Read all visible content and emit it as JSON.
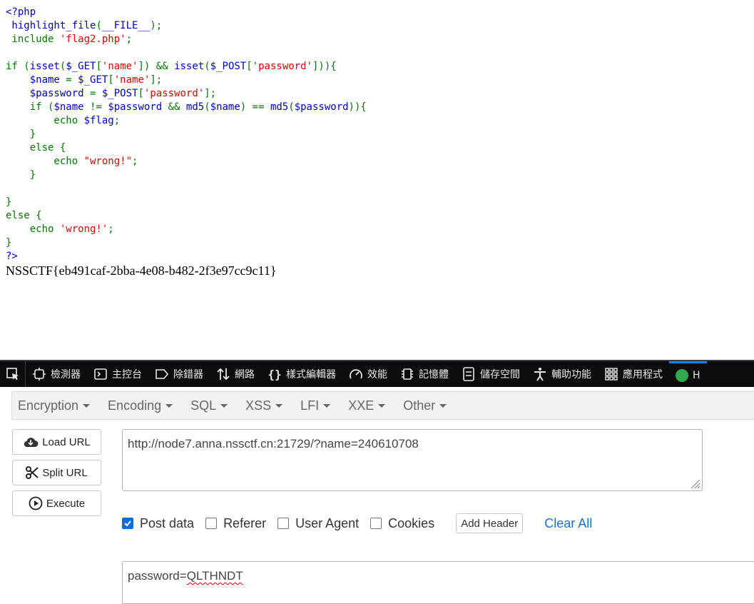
{
  "source": {
    "lines": [
      [
        [
          "default",
          "<?php"
        ]
      ],
      [
        [
          "default",
          " highlight_file"
        ],
        [
          "keyword",
          "("
        ],
        [
          "default",
          "__FILE__"
        ],
        [
          "keyword",
          ");"
        ]
      ],
      [
        [
          "keyword",
          " include "
        ],
        [
          "string",
          "'flag2.php'"
        ],
        [
          "keyword",
          ";"
        ]
      ],
      [],
      [
        [
          "keyword",
          "if ("
        ],
        [
          "default",
          "isset"
        ],
        [
          "keyword",
          "("
        ],
        [
          "default",
          "$_GET"
        ],
        [
          "keyword",
          "["
        ],
        [
          "string",
          "'name'"
        ],
        [
          "keyword",
          "]) && "
        ],
        [
          "default",
          "isset"
        ],
        [
          "keyword",
          "("
        ],
        [
          "default",
          "$_POST"
        ],
        [
          "keyword",
          "["
        ],
        [
          "string",
          "'password'"
        ],
        [
          "keyword",
          "])){"
        ]
      ],
      [
        [
          "keyword",
          "    "
        ],
        [
          "default",
          "$name "
        ],
        [
          "keyword",
          "= "
        ],
        [
          "default",
          "$_GET"
        ],
        [
          "keyword",
          "["
        ],
        [
          "string",
          "'name'"
        ],
        [
          "keyword",
          "];"
        ]
      ],
      [
        [
          "keyword",
          "    "
        ],
        [
          "default",
          "$password "
        ],
        [
          "keyword",
          "= "
        ],
        [
          "default",
          "$_POST"
        ],
        [
          "keyword",
          "["
        ],
        [
          "string",
          "'password'"
        ],
        [
          "keyword",
          "];"
        ]
      ],
      [
        [
          "keyword",
          "    if ("
        ],
        [
          "default",
          "$name "
        ],
        [
          "keyword",
          "!= "
        ],
        [
          "default",
          "$password "
        ],
        [
          "keyword",
          "&& "
        ],
        [
          "default",
          "md5"
        ],
        [
          "keyword",
          "("
        ],
        [
          "default",
          "$name"
        ],
        [
          "keyword",
          ") == "
        ],
        [
          "default",
          "md5"
        ],
        [
          "keyword",
          "("
        ],
        [
          "default",
          "$password"
        ],
        [
          "keyword",
          ")){"
        ]
      ],
      [
        [
          "keyword",
          "        echo "
        ],
        [
          "default",
          "$flag"
        ],
        [
          "keyword",
          ";"
        ]
      ],
      [
        [
          "keyword",
          "    }"
        ]
      ],
      [
        [
          "keyword",
          "    else {"
        ]
      ],
      [
        [
          "keyword",
          "        echo "
        ],
        [
          "string",
          "\"wrong!\""
        ],
        [
          "keyword",
          ";"
        ]
      ],
      [
        [
          "keyword",
          "    }"
        ]
      ],
      [],
      [
        [
          "keyword",
          "}"
        ]
      ],
      [
        [
          "keyword",
          "else {"
        ]
      ],
      [
        [
          "keyword",
          "    echo "
        ],
        [
          "string",
          "'wrong!'"
        ],
        [
          "keyword",
          ";"
        ]
      ],
      [
        [
          "keyword",
          "}"
        ]
      ],
      [
        [
          "default",
          "?>"
        ]
      ]
    ]
  },
  "flag_output": "NSSCTF{eb491caf-2bba-4e08-b482-2f3e97cc9c11}",
  "devtools": {
    "tabs": [
      {
        "icon": "inspector-icon",
        "label": "檢測器"
      },
      {
        "icon": "console-icon",
        "label": "主控台"
      },
      {
        "icon": "debugger-icon",
        "label": "除錯器"
      },
      {
        "icon": "network-icon",
        "label": "網路"
      },
      {
        "icon": "style-editor-icon",
        "label": "樣式編輯器"
      },
      {
        "icon": "performance-icon",
        "label": "效能"
      },
      {
        "icon": "memory-icon",
        "label": "記憶體"
      },
      {
        "icon": "storage-icon",
        "label": "儲存空間"
      },
      {
        "icon": "accessibility-icon",
        "label": "輔助功能"
      },
      {
        "icon": "application-icon",
        "label": "應用程式"
      },
      {
        "icon": "hackbar-icon",
        "label": "H"
      }
    ]
  },
  "hackbar": {
    "menu": [
      "Encryption",
      "Encoding",
      "SQL",
      "XSS",
      "LFI",
      "XXE",
      "Other"
    ],
    "buttons": {
      "load_url": "Load URL",
      "split_url": "Split URL",
      "execute": "Execute"
    },
    "url_value": "http://node7.anna.nssctf.cn:21729/?name=240610708",
    "options": {
      "post_data": {
        "label": "Post data",
        "checked": true
      },
      "referer": {
        "label": "Referer",
        "checked": false
      },
      "user_agent": {
        "label": "User Agent",
        "checked": false
      },
      "cookies": {
        "label": "Cookies",
        "checked": false
      }
    },
    "add_header": "Add Header",
    "clear_all": "Clear All",
    "post_key": "password=",
    "post_value": "QLTHNDT"
  },
  "colors": {
    "php_default": "#0000BB",
    "php_keyword": "#007700",
    "php_string": "#DD0000",
    "devtools_bg": "#0c0c0d",
    "link_blue": "#1a73c8",
    "checkbox_blue": "#0a6ed1"
  }
}
